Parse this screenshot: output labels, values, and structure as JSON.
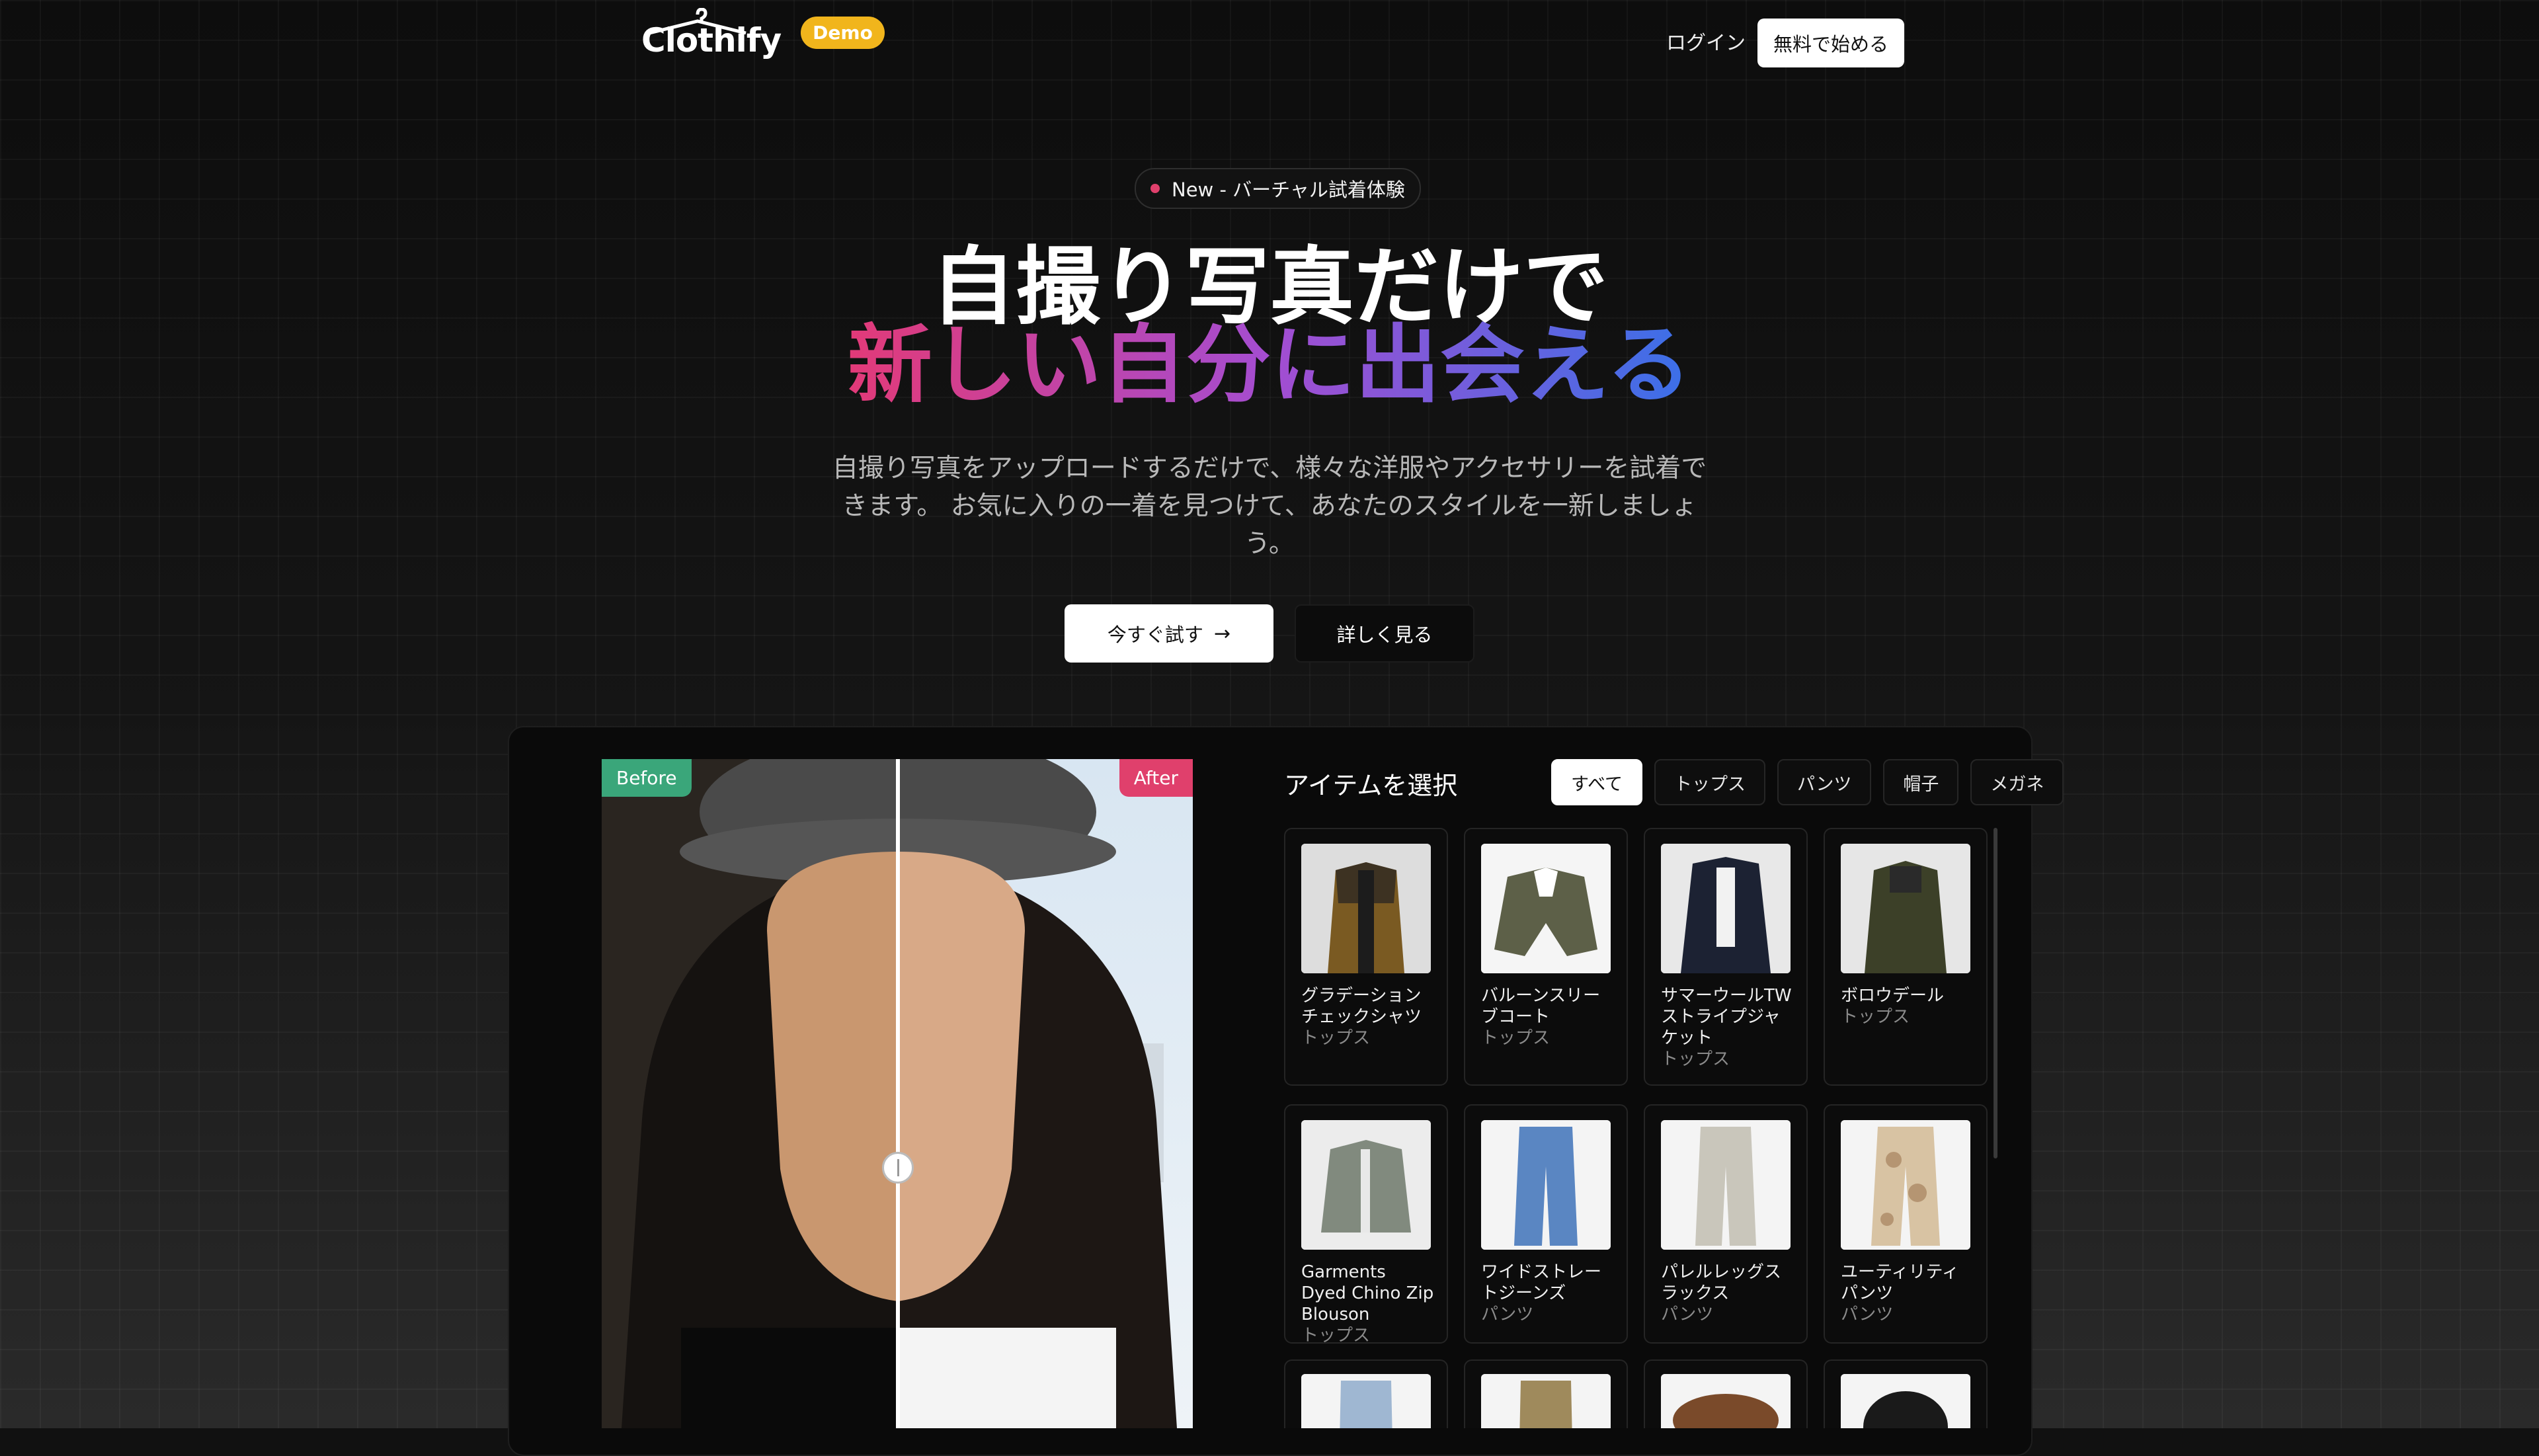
{
  "nav": {
    "logo": "Clothify",
    "badge": "Demo",
    "login": "ログイン",
    "start": "無料で始める"
  },
  "hero": {
    "pill": "New - バーチャル試着体験",
    "title_line1": "自撮り写真だけで",
    "title_line2": "新しい自分に出会える",
    "subtitle": "自撮り写真をアップロードするだけで、様々な洋服やアクセサリーを試着できます。 お気に入りの一着を見つけて、あなたのスタイルを一新しましょう。",
    "cta_primary": "今すぐ試す",
    "cta_secondary": "詳しく見る"
  },
  "compare": {
    "before_label": "Before",
    "after_label": "After",
    "slider_position": 0.5
  },
  "items": {
    "title": "アイテムを選択",
    "filters": [
      "すべて",
      "トップス",
      "パンツ",
      "帽子",
      "メガネ"
    ],
    "active_filter": "すべて",
    "cards": [
      {
        "name": "グラデーションチェックシャツ",
        "category": "トップス"
      },
      {
        "name": "バルーンスリーブコート",
        "category": "トップス"
      },
      {
        "name": "サマーウールTWストライプジャケット",
        "category": "トップス"
      },
      {
        "name": "ボロウデール",
        "category": "トップス"
      },
      {
        "name": "Garments Dyed Chino Zip Blouson",
        "category": "トップス"
      },
      {
        "name": "ワイドストレートジーンズ",
        "category": "パンツ"
      },
      {
        "name": "パレルレッグスラックス",
        "category": "パンツ"
      },
      {
        "name": "ユーティリティパンツ",
        "category": "パンツ"
      },
      {
        "name": "",
        "category": ""
      },
      {
        "name": "",
        "category": ""
      },
      {
        "name": "",
        "category": ""
      },
      {
        "name": "",
        "category": ""
      }
    ]
  },
  "colors": {
    "accent_pink": "#e0406c",
    "accent_green": "#3aa67a",
    "demo_yellow": "#f1b51c",
    "gradient_start": "#e23a78",
    "gradient_end": "#3a70e8"
  }
}
